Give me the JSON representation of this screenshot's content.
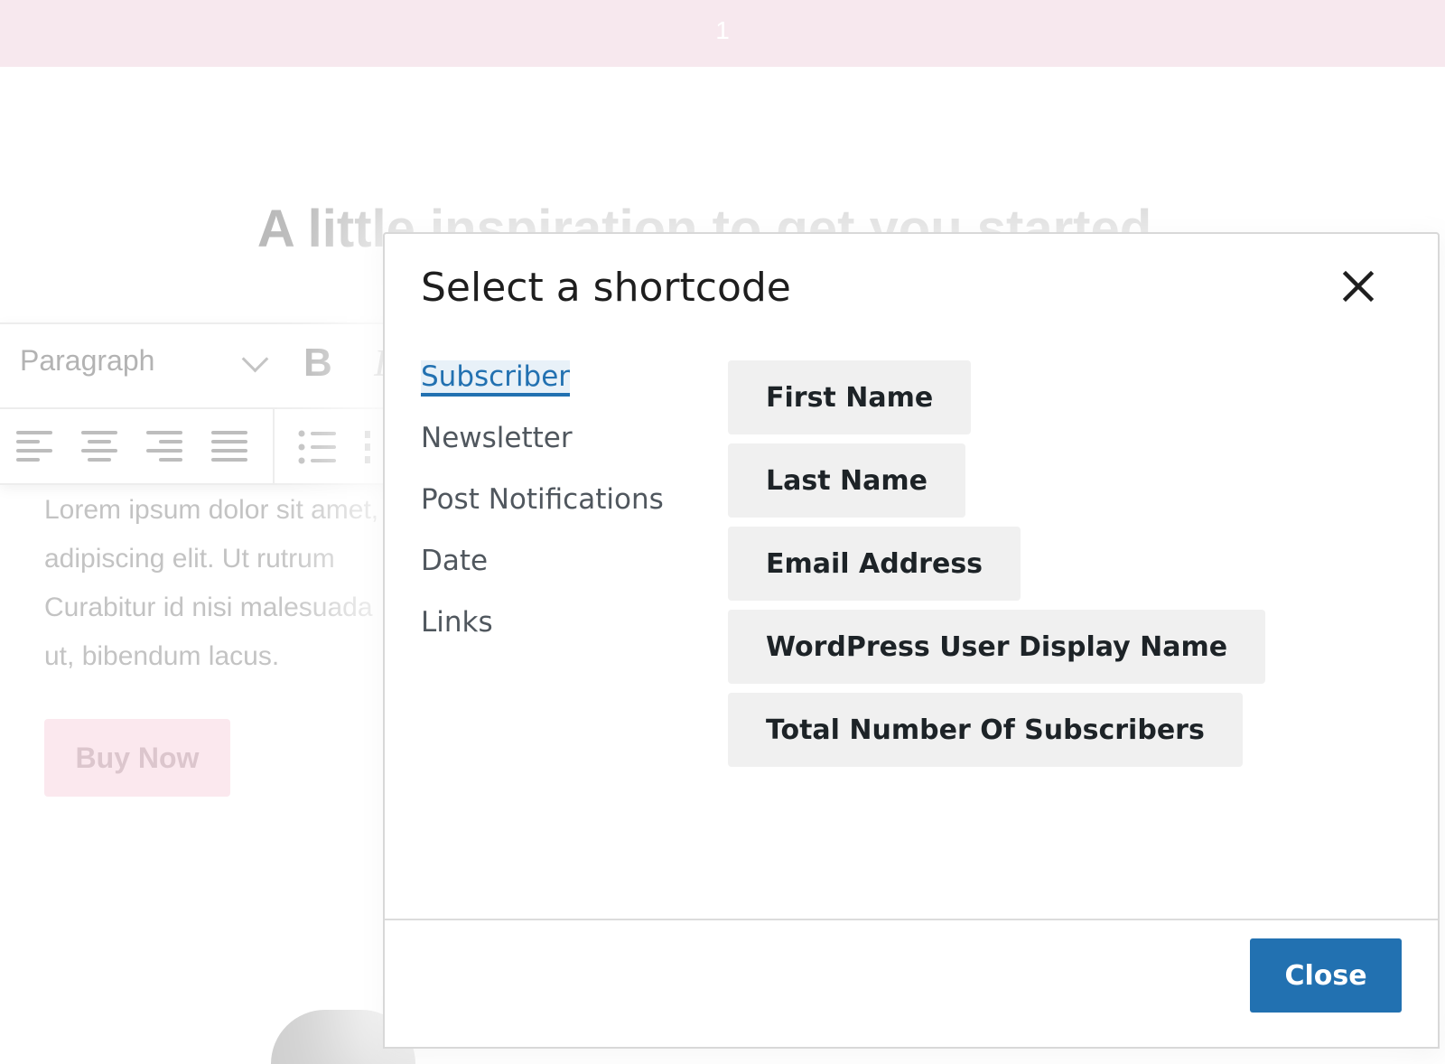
{
  "background": {
    "page_number": "1",
    "headline": "A little inspiration to get you started",
    "toolbar": {
      "block_format": "Paragraph",
      "bold_label": "B",
      "italic_label": "I"
    },
    "lorem_lines": [
      "Lorem ipsum dolor sit amet,",
      "adipiscing elit. Ut rutrum",
      "Curabitur id nisi malesuada",
      "ut, bibendum lacus."
    ],
    "buy_now_label": "Buy Now"
  },
  "modal": {
    "title": "Select a shortcode",
    "close_icon": "close-icon",
    "categories": [
      {
        "label": "Subscriber",
        "active": true
      },
      {
        "label": "Newsletter",
        "active": false
      },
      {
        "label": "Post Notifications",
        "active": false
      },
      {
        "label": "Date",
        "active": false
      },
      {
        "label": "Links",
        "active": false
      }
    ],
    "shortcodes": [
      "First Name",
      "Last Name",
      "Email Address",
      "WordPress User Display Name",
      "Total Number Of Subscribers"
    ],
    "close_button_label": "Close"
  },
  "colors": {
    "accent": "#2271b1",
    "shortcode_bg": "#f0f0f0",
    "top_strip": "#f7e8ee"
  }
}
